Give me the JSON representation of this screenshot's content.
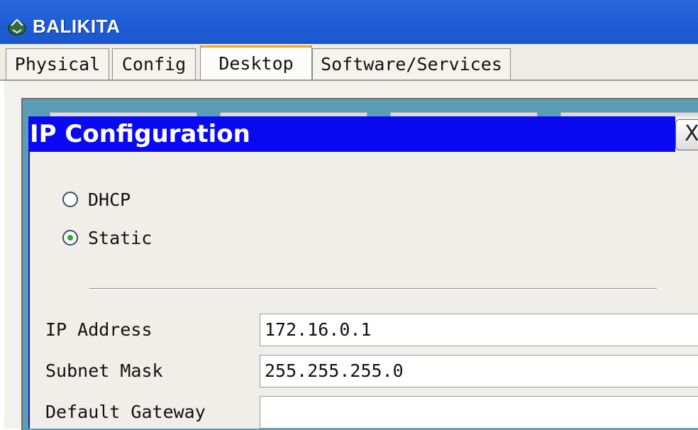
{
  "window": {
    "title": "BALIKITA",
    "icon": "router-icon"
  },
  "tabs": [
    {
      "label": "Physical",
      "active": false
    },
    {
      "label": "Config",
      "active": false
    },
    {
      "label": "Desktop",
      "active": true
    },
    {
      "label": "Software/Services",
      "active": false
    }
  ],
  "dialog": {
    "title": "IP Configuration",
    "close_label": "X",
    "mode_options": [
      {
        "label": "DHCP",
        "selected": false
      },
      {
        "label": "Static",
        "selected": true
      }
    ],
    "fields": [
      {
        "label": "IP Address",
        "value": "172.16.0.1"
      },
      {
        "label": "Subnet Mask",
        "value": "255.255.255.0"
      },
      {
        "label": "Default Gateway",
        "value": ""
      }
    ]
  },
  "colors": {
    "titlebar": "#1f5fd8",
    "dialog_titlebar": "#0a0af2",
    "active_tab_accent": "#f2a12a",
    "desktop_background": "#5b9db7",
    "radio_selected": "#2fa82f"
  }
}
